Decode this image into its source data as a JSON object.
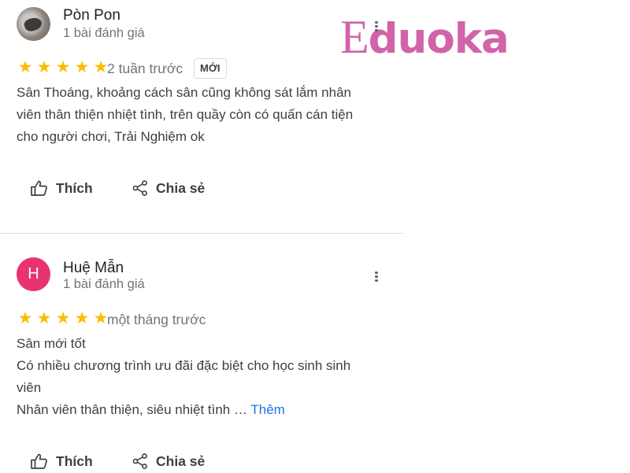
{
  "watermark": {
    "text": "Eduoka",
    "color": "#d163a9"
  },
  "reviews": [
    {
      "name": "Pòn Pon",
      "review_count": "1 bài đánh giá",
      "avatar": {
        "type": "photo"
      },
      "rating": 5,
      "stars": [
        "★",
        "★",
        "★",
        "★",
        "★"
      ],
      "time": "2 tuần trước",
      "badge": "MỚI",
      "text_lines": [
        "Sân Thoáng, khoảng cách sân cũng không sát lắm nhân",
        "viên thân thiện nhiệt tình, trên quầy còn có quấn cán tiện",
        "cho người chơi, Trải Nghiệm ok"
      ],
      "actions": {
        "like": "Thích",
        "share": "Chia sẻ"
      }
    },
    {
      "name": "Huệ Mẫn",
      "review_count": "1 bài đánh giá",
      "avatar": {
        "type": "letter",
        "letter": "H",
        "color": "#e8336f"
      },
      "rating": 5,
      "stars": [
        "★",
        "★",
        "★",
        "★",
        "★"
      ],
      "time": "một tháng trước",
      "text_lines": [
        "Sân mới tốt",
        "Có nhiều chương trình ưu đãi đặc biệt cho học sinh sinh",
        "viên"
      ],
      "text_last": "Nhân viên thân thiện, siêu nhiệt tình … ",
      "more_label": "Thêm",
      "actions": {
        "like": "Thích",
        "share": "Chia sẻ"
      }
    }
  ],
  "colors": {
    "star": "#fbbc04",
    "link": "#1a73e8",
    "divider": "#dadce0"
  }
}
